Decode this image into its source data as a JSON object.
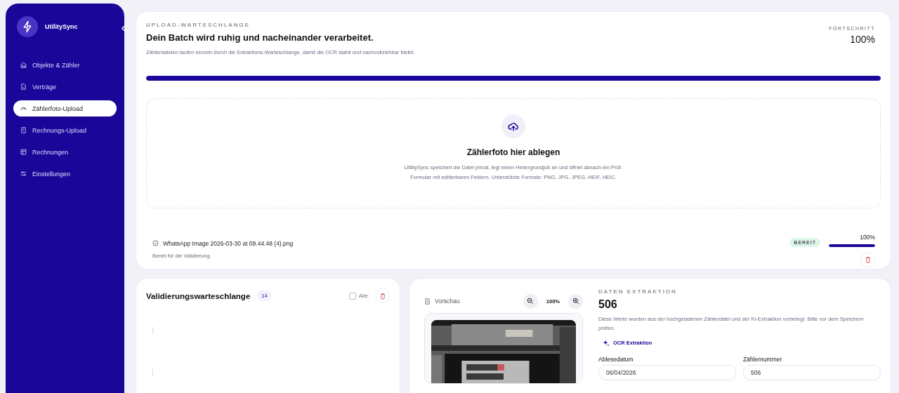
{
  "sidebar": {
    "brand": "UtilitySync",
    "items": [
      {
        "label": "Objekte & Zähler",
        "kind": "building",
        "selected": false
      },
      {
        "label": "Verträge",
        "kind": "document",
        "selected": false
      },
      {
        "label": "Zählerfoto-Upload",
        "kind": "gauge",
        "selected": true
      },
      {
        "label": "Rechnungs-Upload",
        "kind": "receipt",
        "selected": false
      },
      {
        "label": "Rechnungen",
        "kind": "table",
        "selected": false
      },
      {
        "label": "Einstellungen",
        "kind": "sliders",
        "selected": false
      }
    ]
  },
  "upload_queue": {
    "eyebrow": "UPLOAD-WARTESCHLANGE",
    "title": "Dein Batch wird ruhig und nacheinander verarbeitet.",
    "description": "Zählerdateien laufen einzeln durch die Extraktions-Warteschlange, damit die OCR stabil und nachvollziehbar bleibt.",
    "progress_label": "FORTSCHRITT",
    "progress_value": "100%",
    "level": 1,
    "dropzone": {
      "title": "Zählerfoto hier ablegen",
      "text": "UtilitySync speichert die Datei privat, legt einen Hintergrundjob an und öffnet danach ein Prüf-Formular mit editierbaren Feldern. Unterstützte Formate: PNG, JPG, JPEG, HEIF, HEIC."
    },
    "files": [
      {
        "name": "WhatsApp Image 2026-03-30 at 09.44.48 (4).png",
        "status": "Bereit für die Validierung.",
        "badge": "BEREIT",
        "percent": "100%",
        "level": 1
      }
    ]
  },
  "validation_queue": {
    "title": "Validierungswarteschlange",
    "count": "14",
    "select_all": {
      "label": "Alle",
      "checked": false
    }
  },
  "preview": {
    "label": "Vorschau",
    "zoom": "100%"
  },
  "extraction": {
    "eyebrow": "DATEN EXTRAKTION",
    "title": "506",
    "description": "Diese Werte wurden aus der hochgeladenen Zählerdatei und der KI-Extraktion vorbelegt. Bitte vor dem Speichern prüfen.",
    "button": "OCR Extraktion",
    "fields": [
      {
        "label": "Ablesedatum",
        "value": "06/04/2026"
      },
      {
        "label": "Zählernummer",
        "value": "506"
      }
    ]
  }
}
